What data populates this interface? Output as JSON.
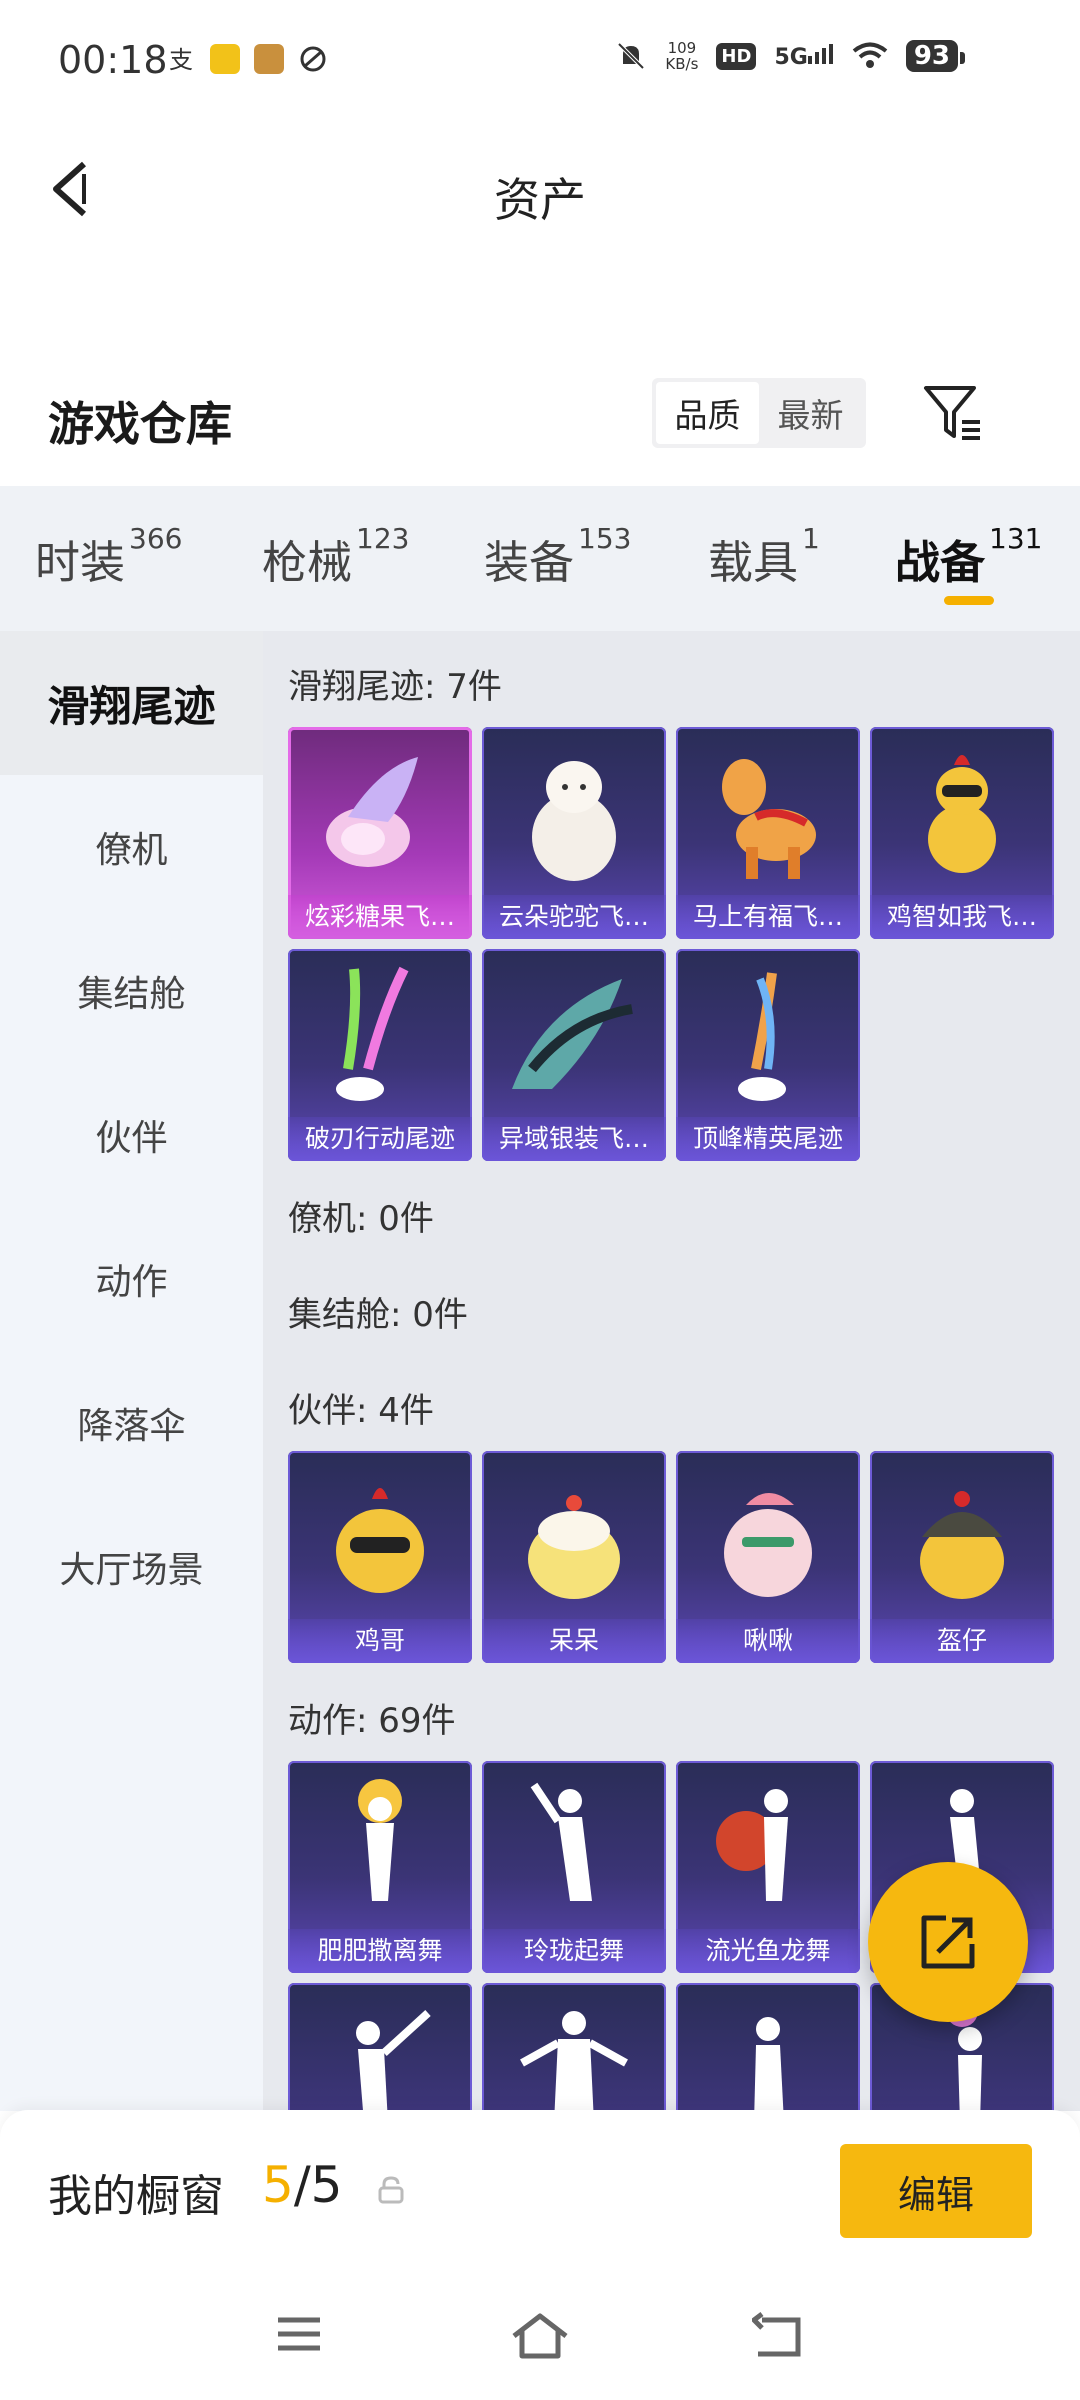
{
  "status": {
    "time": "00:18",
    "net_speed_value": "109",
    "net_speed_unit": "KB/s",
    "hd": "HD",
    "signal": "5G",
    "battery": "93"
  },
  "header": {
    "title": "资产"
  },
  "warehouse": {
    "title": "游戏仓库",
    "sort_quality": "品质",
    "sort_latest": "最新"
  },
  "tabs": [
    {
      "label": "时装",
      "count": "366"
    },
    {
      "label": "枪械",
      "count": "123"
    },
    {
      "label": "装备",
      "count": "153"
    },
    {
      "label": "载具",
      "count": "1"
    },
    {
      "label": "战备",
      "count": "131"
    }
  ],
  "sidebar": [
    "滑翔尾迹",
    "僚机",
    "集结舱",
    "伙伴",
    "动作",
    "降落伞",
    "大厅场景"
  ],
  "sections": {
    "glide": {
      "title": "滑翔尾迹: 7件",
      "items": [
        "炫彩糖果飞…",
        "云朵驼驼飞…",
        "马上有福飞…",
        "鸡智如我飞…",
        "破刃行动尾迹",
        "异域银装飞…",
        "顶峰精英尾迹"
      ]
    },
    "wingman": {
      "title": "僚机: 0件"
    },
    "pod": {
      "title": "集结舱: 0件"
    },
    "partner": {
      "title": "伙伴: 4件",
      "items": [
        "鸡哥",
        "呆呆",
        "啾啾",
        "盔仔"
      ]
    },
    "emote": {
      "title": "动作: 69件",
      "items": [
        "肥肥撒离舞",
        "玲珑起舞",
        "流光鱼龙舞",
        ""
      ]
    }
  },
  "showcase": {
    "label": "我的橱窗",
    "current": "5",
    "total": "/5",
    "edit_label": "编辑"
  },
  "colors": {
    "accent": "#f6b80f",
    "card": "#3b3476",
    "card_highlight": "#d35cdc"
  }
}
